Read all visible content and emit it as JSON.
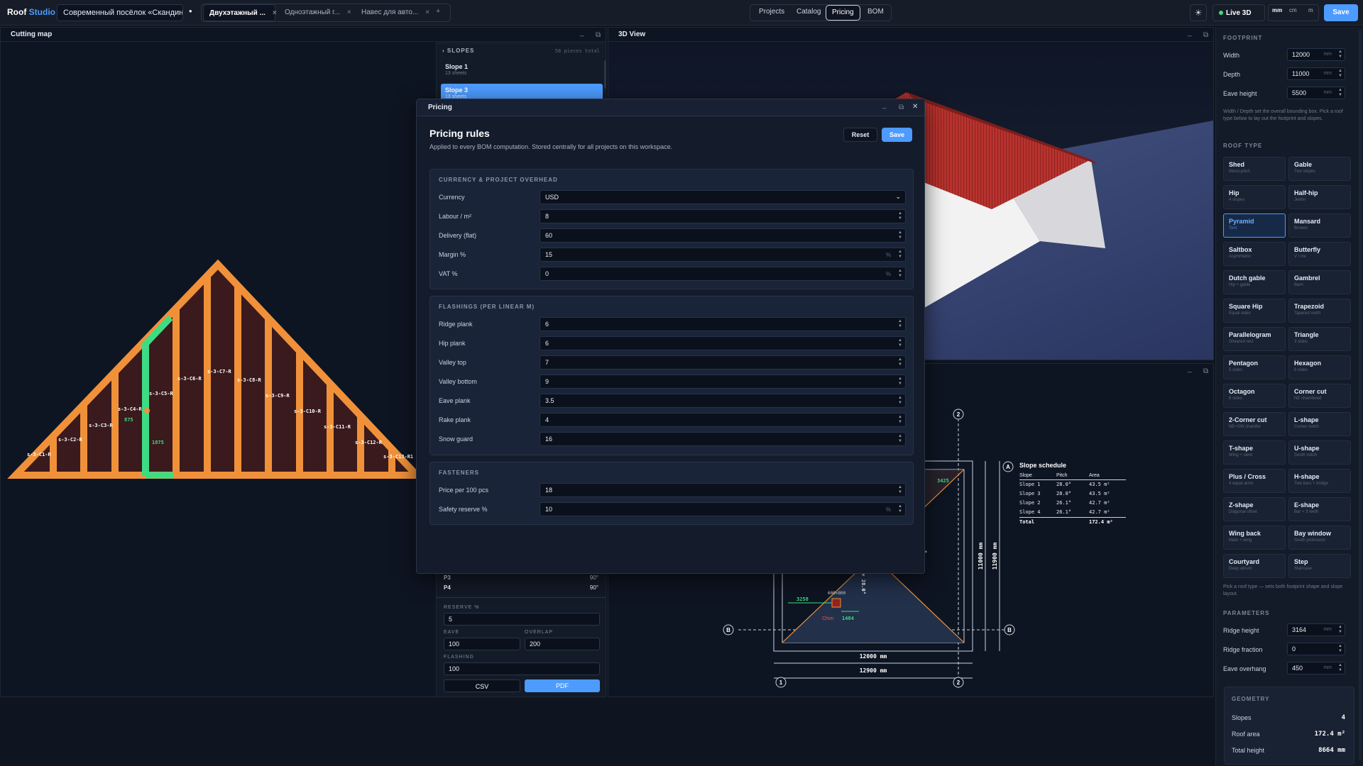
{
  "app": {
    "logo_a": "Roof",
    "logo_b": "Studio"
  },
  "topbar": {
    "project_name": "Современный посёлок «Скандинавия»",
    "dot": "•",
    "tabs": [
      {
        "label": "Двухэтажный ...",
        "close": "×"
      },
      {
        "label": "Одноэтажный г...",
        "close": "×"
      },
      {
        "label": "Навес для авто...",
        "close": "×"
      }
    ],
    "add_tab": "+",
    "nav": [
      "Projects",
      "Catalog",
      "Pricing",
      "BOM"
    ],
    "theme_icon": "☀",
    "live_label": "Live 3D",
    "units": [
      "mm",
      "cm",
      "m"
    ],
    "save": "Save"
  },
  "cutting": {
    "title": "Cutting map",
    "min": "_",
    "pop": "⧉",
    "slopes_header": "SLOPES",
    "slopes_caret": "›",
    "pieces_total": "58 pieces total",
    "slopes": [
      {
        "name": "Slope 1",
        "sheets": "13 sheets"
      },
      {
        "name": "Slope 3",
        "sheets": "13 sheets"
      }
    ],
    "piece_labels": [
      "s-3-C1-R",
      "s-3-C2-R",
      "s-3-C3-R",
      "s-3-C4-R",
      "s-3-C5-R",
      "s-3-C6-R",
      "s-3-C7-R",
      "s-3-C8-R",
      "s-3-C9-R",
      "s-3-C10-R",
      "s-3-C11-R",
      "s-3-C12-R",
      "s-3-C13-R1"
    ],
    "dim_a": "875",
    "dim_b": "1875",
    "angles": [
      {
        "name": "P3",
        "value": "90°"
      },
      {
        "name": "P4",
        "value": "90°"
      }
    ],
    "reserve_label": "RESERVE %",
    "reserve": "5",
    "eave_label": "EAVE",
    "eave": "100",
    "overlap_label": "OVERLAP",
    "overlap": "200",
    "flashing_label": "FLASHING",
    "flashing": "100",
    "csv": "CSV",
    "pdf": "PDF"
  },
  "view3d": {
    "title": "3D View",
    "min": "_",
    "pop": "⧉"
  },
  "plan": {
    "min": "_",
    "pop": "⧉",
    "axis": [
      "1",
      "2",
      "A",
      "B"
    ],
    "dim_w1": "12000 mm",
    "dim_w2": "12900 mm",
    "dim_h1": "11000 mm",
    "dim_h2": "11900 mm",
    "dim_3425": "3425",
    "dim_3258": "3258",
    "dim_600": "600×800",
    "dim_1484": "1484",
    "chim": "Chim",
    "pitch": "1 × 28.0°",
    "pitch2": "1°",
    "schedule_title": "Slope schedule",
    "schedule_headers": [
      "Slope",
      "Pitch",
      "Area"
    ],
    "schedule": [
      [
        "Slope 1",
        "28.0°",
        "43.5 m²"
      ],
      [
        "Slope 3",
        "28.0°",
        "43.5 m²"
      ],
      [
        "Slope 2",
        "26.1°",
        "42.7 m²"
      ],
      [
        "Slope 4",
        "26.1°",
        "42.7 m²"
      ]
    ],
    "total_label": "Total",
    "total_value": "172.4 m²"
  },
  "dialog": {
    "title": "Pricing",
    "min": "_",
    "max": "⧉",
    "close": "✕",
    "heading": "Pricing rules",
    "description": "Applied to every BOM computation. Stored centrally for all projects on this workspace.",
    "reset": "Reset",
    "save": "Save",
    "sections": [
      {
        "title": "CURRENCY & PROJECT OVERHEAD",
        "rows": [
          {
            "label": "Currency",
            "value": "USD",
            "kind": "select"
          },
          {
            "label": "Labour / m²",
            "value": "8"
          },
          {
            "label": "Delivery (flat)",
            "value": "60"
          },
          {
            "label": "Margin %",
            "value": "15",
            "unit": "%"
          },
          {
            "label": "VAT %",
            "value": "0",
            "unit": "%"
          }
        ]
      },
      {
        "title": "FLASHINGS (PER LINEAR M)",
        "rows": [
          {
            "label": "Ridge plank",
            "value": "6"
          },
          {
            "label": "Hip plank",
            "value": "6"
          },
          {
            "label": "Valley top",
            "value": "7"
          },
          {
            "label": "Valley bottom",
            "value": "9"
          },
          {
            "label": "Eave plank",
            "value": "3.5"
          },
          {
            "label": "Rake plank",
            "value": "4"
          },
          {
            "label": "Snow guard",
            "value": "16"
          }
        ]
      },
      {
        "title": "FASTENERS",
        "rows": [
          {
            "label": "Price per 100 pcs",
            "value": "18"
          },
          {
            "label": "Safety reserve %",
            "value": "10",
            "unit": "%"
          }
        ]
      }
    ],
    "spin_up": "▲",
    "spin_down": "▼",
    "caret": "⌄"
  },
  "sidebar": {
    "footprint_title": "FOOTPRINT",
    "footprint": [
      {
        "label": "Width",
        "value": "12000",
        "unit": "mm"
      },
      {
        "label": "Depth",
        "value": "11000",
        "unit": "mm"
      },
      {
        "label": "Eave height",
        "value": "5500",
        "unit": "mm"
      }
    ],
    "footprint_note": "Width / Depth set the overall bounding box. Pick a roof type below to lay out the footprint and slopes.",
    "roof_type_title": "ROOF TYPE",
    "roof_types": [
      {
        "name": "Shed",
        "sub": "Mono-pitch"
      },
      {
        "name": "Gable",
        "sub": "Two slopes"
      },
      {
        "name": "Hip",
        "sub": "4 slopes"
      },
      {
        "name": "Half-hip",
        "sub": "Jerkin"
      },
      {
        "name": "Pyramid",
        "sub": "Tent"
      },
      {
        "name": "Mansard",
        "sub": "Broken"
      },
      {
        "name": "Saltbox",
        "sub": "Asymmetric"
      },
      {
        "name": "Butterfly",
        "sub": "V / inv."
      },
      {
        "name": "Dutch gable",
        "sub": "Hip + gable"
      },
      {
        "name": "Gambrel",
        "sub": "Barn"
      },
      {
        "name": "Square Hip",
        "sub": "Equal sides"
      },
      {
        "name": "Trapezoid",
        "sub": "Tapered north"
      },
      {
        "name": "Parallelogram",
        "sub": "Sheared rect"
      },
      {
        "name": "Triangle",
        "sub": "3 sides"
      },
      {
        "name": "Pentagon",
        "sub": "5 sides"
      },
      {
        "name": "Hexagon",
        "sub": "6 sides"
      },
      {
        "name": "Octagon",
        "sub": "8 sides"
      },
      {
        "name": "Corner cut",
        "sub": "NE chamfered"
      },
      {
        "name": "2-Corner cut",
        "sub": "NE+SW chamfer"
      },
      {
        "name": "L-shape",
        "sub": "Corner notch"
      },
      {
        "name": "T-shape",
        "sub": "Wing + stem"
      },
      {
        "name": "U-shape",
        "sub": "South notch"
      },
      {
        "name": "Plus / Cross",
        "sub": "4 equal arms"
      },
      {
        "name": "H-shape",
        "sub": "Two bars + bridge"
      },
      {
        "name": "Z-shape",
        "sub": "Diagonal offset"
      },
      {
        "name": "E-shape",
        "sub": "Bar + 3 teeth"
      },
      {
        "name": "Wing back",
        "sub": "Main + wing"
      },
      {
        "name": "Bay window",
        "sub": "South protrusion"
      },
      {
        "name": "Courtyard",
        "sub": "Deep atrium"
      },
      {
        "name": "Step",
        "sub": "Staircase"
      }
    ],
    "selected_roof": "Pyramid",
    "roof_note": "Pick a roof type — sets both footprint shape and slope layout.",
    "parameters_title": "PARAMETERS",
    "parameters": [
      {
        "label": "Ridge height",
        "value": "3164",
        "unit": "mm"
      },
      {
        "label": "Ridge fraction",
        "value": "0",
        "unit": ""
      },
      {
        "label": "Eave overhang",
        "value": "450",
        "unit": "mm"
      }
    ],
    "geometry_title": "GEOMETRY",
    "geometry": [
      {
        "label": "Slopes",
        "value": "4"
      },
      {
        "label": "Roof area",
        "value": "172.4 m²"
      },
      {
        "label": "Total height",
        "value": "8664 mm"
      }
    ]
  },
  "colors": {
    "accent": "#4d9bff",
    "sheet_orange": "#f0913a",
    "sheet_highlight": "#3ddc84",
    "roof_red": "#b8322e"
  }
}
